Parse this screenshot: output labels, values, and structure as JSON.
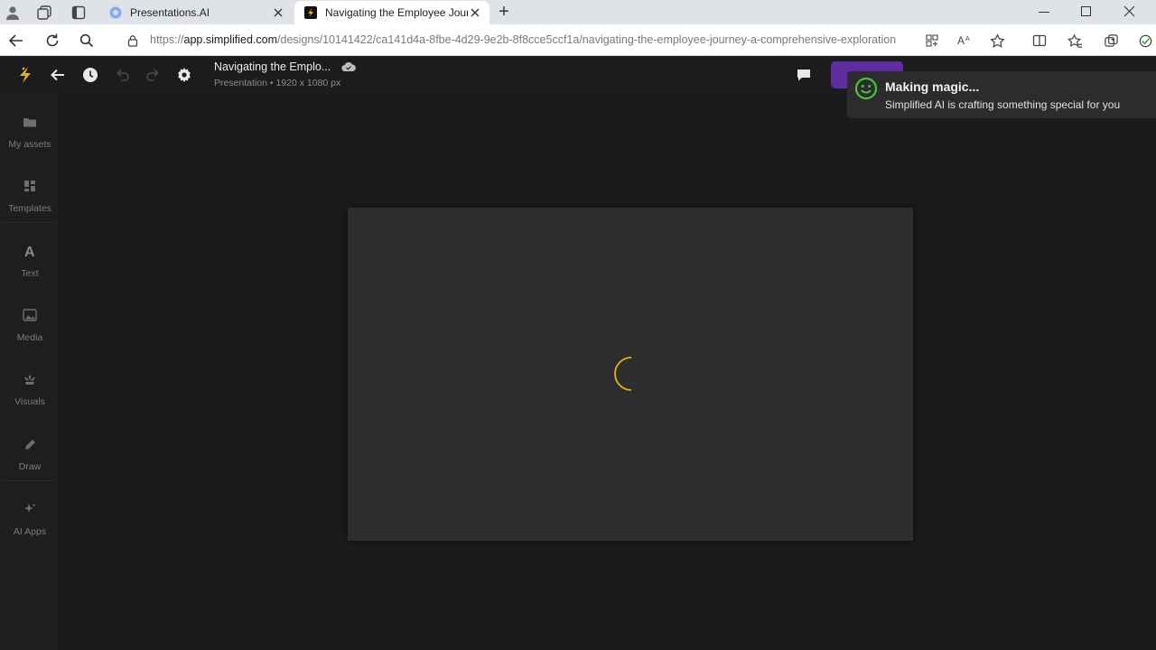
{
  "browser": {
    "tabs": [
      {
        "label": "Presentations.AI",
        "active": false
      },
      {
        "label": "Navigating the Employee Journe",
        "active": true
      }
    ],
    "new_tab_label": "+",
    "url_prefix": "https://",
    "url_host": "app.simplified.com",
    "url_path": "/designs/10141422/ca141d4a-8fbe-4d29-9e2b-8f8cce5ccf1a/navigating-the-employee-journey-a-comprehensive-exploration"
  },
  "header": {
    "title": "Navigating the Emplo...",
    "subtitle": "Presentation • 1920 x 1080 px"
  },
  "sidebar": {
    "items": [
      {
        "label": "My assets",
        "icon": "folder-icon"
      },
      {
        "label": "Templates",
        "icon": "templates-icon"
      },
      {
        "label": "Text",
        "icon": "text-icon"
      },
      {
        "label": "Media",
        "icon": "image-icon"
      },
      {
        "label": "Visuals",
        "icon": "visuals-icon"
      },
      {
        "label": "Draw",
        "icon": "pencil-icon"
      },
      {
        "label": "AI Apps",
        "icon": "sparkle-icon"
      }
    ]
  },
  "toast": {
    "title": "Making magic...",
    "message": "Simplified AI is crafting something special for you"
  },
  "colors": {
    "accent_yellow": "#e6b31e",
    "toast_green": "#4cc23a",
    "purple": "#5e2ea0"
  }
}
